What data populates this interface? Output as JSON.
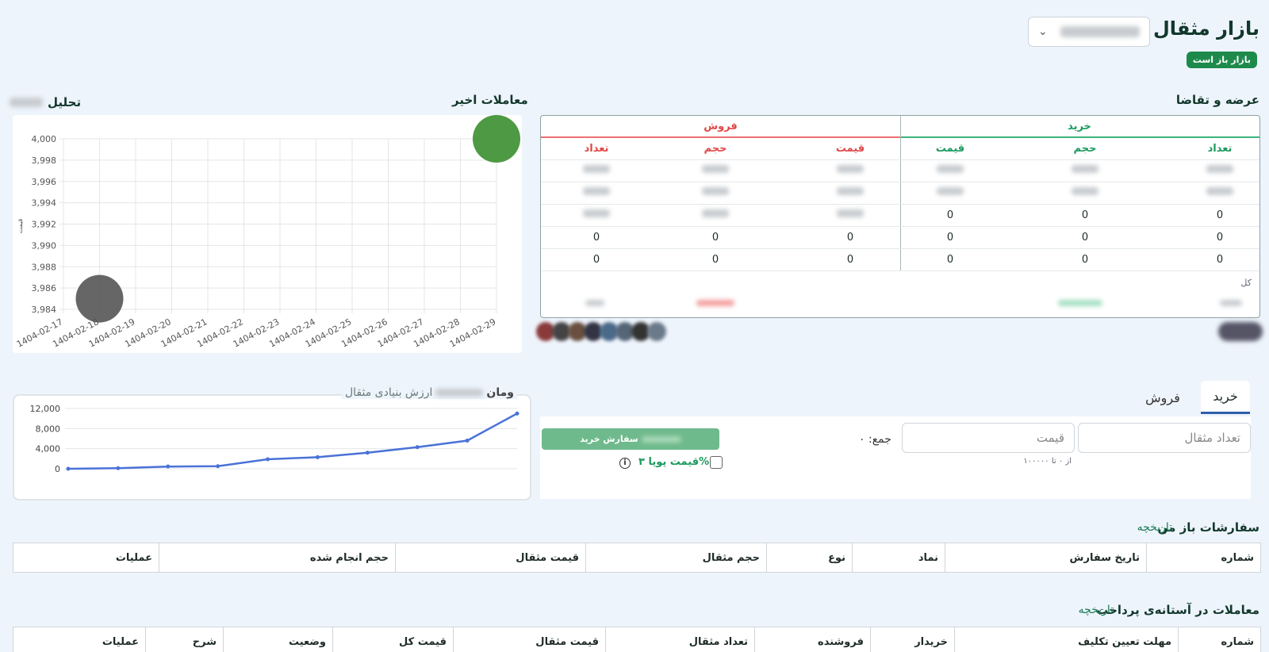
{
  "header": {
    "title": "بازار مثقال",
    "status_badge": "بازار باز است",
    "symbol_select_chevron": "⌄"
  },
  "orderbook": {
    "title": "عرضه و تقاضا",
    "buy_label": "خرید",
    "sell_label": "فروش",
    "columns": {
      "buy_count": "تعداد",
      "buy_volume": "حجم",
      "buy_price": "قیمت",
      "sell_price": "قیمت",
      "sell_volume": "حجم",
      "sell_count": "تعداد"
    },
    "rows": [
      {
        "buy_count": "",
        "buy_volume": "",
        "buy_price": "",
        "sell_price": "",
        "sell_volume": "",
        "sell_count": ""
      },
      {
        "buy_count": "",
        "buy_volume": "",
        "buy_price": "",
        "sell_price": "",
        "sell_volume": "",
        "sell_count": ""
      },
      {
        "buy_count": "0",
        "buy_volume": "0",
        "buy_price": "0",
        "sell_price": "",
        "sell_volume": "",
        "sell_count": ""
      },
      {
        "buy_count": "0",
        "buy_volume": "0",
        "buy_price": "0",
        "sell_price": "0",
        "sell_volume": "0",
        "sell_count": "0"
      },
      {
        "buy_count": "0",
        "buy_volume": "0",
        "buy_price": "0",
        "sell_price": "0",
        "sell_volume": "0",
        "sell_count": "0"
      }
    ],
    "total_label": "کل"
  },
  "trades": {
    "title": "معاملات اخیر"
  },
  "analysis": {
    "title": "تحلیل"
  },
  "fundamental": {
    "legend_prefix": "ارزش بنیادی مثقال",
    "legend_suffix": "ومان"
  },
  "order_form": {
    "tab_buy": "خرید",
    "tab_sell": "فروش",
    "qty_placeholder": "تعداد مثقال",
    "price_placeholder": "قیمت",
    "range_note": "از ۰ تا ۱۰۰۰۰۰",
    "sum_label": "جمع: ۰",
    "submit_label": "سفارش خرید",
    "dynamic_price_label": "قیمت پویا ۳%",
    "info_icon": "i"
  },
  "open_orders": {
    "title": "سفارشات باز من",
    "history_link": "تاریخچه",
    "columns": [
      "شماره",
      "تاریخ سفارش",
      "نماد",
      "نوع",
      "حجم مثقال",
      "قیمت مثقال",
      "حجم انجام شده",
      "عملیات"
    ]
  },
  "pending_trades": {
    "title": "معاملات در آستانه‌ی پرداخت",
    "history_link": "تاریخچه",
    "columns": [
      "شماره",
      "مهلت تعیین تکلیف",
      "خریدار",
      "فروشنده",
      "تعداد مثقال",
      "قیمت مثقال",
      "قیمت کل",
      "وضعیت",
      "شرح",
      "عملیات"
    ]
  },
  "chart_data": [
    {
      "type": "scatter",
      "title": "",
      "ylabel": "قیمت",
      "xlabel": "",
      "x_ticks": [
        "1404-02-17",
        "1404-02-18",
        "1404-02-19",
        "1404-02-20",
        "1404-02-21",
        "1404-02-22",
        "1404-02-23",
        "1404-02-24",
        "1404-02-25",
        "1404-02-26",
        "1404-02-27",
        "1404-02-28",
        "1404-02-29"
      ],
      "y_ticks": [
        "3,984",
        "3,986",
        "3,988",
        "3,990",
        "3,992",
        "3,994",
        "3,996",
        "3,998",
        "4,000"
      ],
      "ylim": [
        3984,
        4000
      ],
      "grid": true,
      "points": [
        {
          "x": "1404-02-18",
          "y": 3985,
          "color": "#555555"
        },
        {
          "x": "1404-02-29",
          "y": 4000,
          "color": "#3b8e2f"
        }
      ]
    },
    {
      "type": "line",
      "title": "",
      "y_ticks": [
        "0",
        "4,000",
        "8,000",
        "12,000"
      ],
      "ylim": [
        0,
        12000
      ],
      "grid": true,
      "color": "#4a72d8",
      "values": [
        0,
        120,
        450,
        520,
        1900,
        2300,
        3200,
        4300,
        5600,
        11000
      ]
    }
  ]
}
